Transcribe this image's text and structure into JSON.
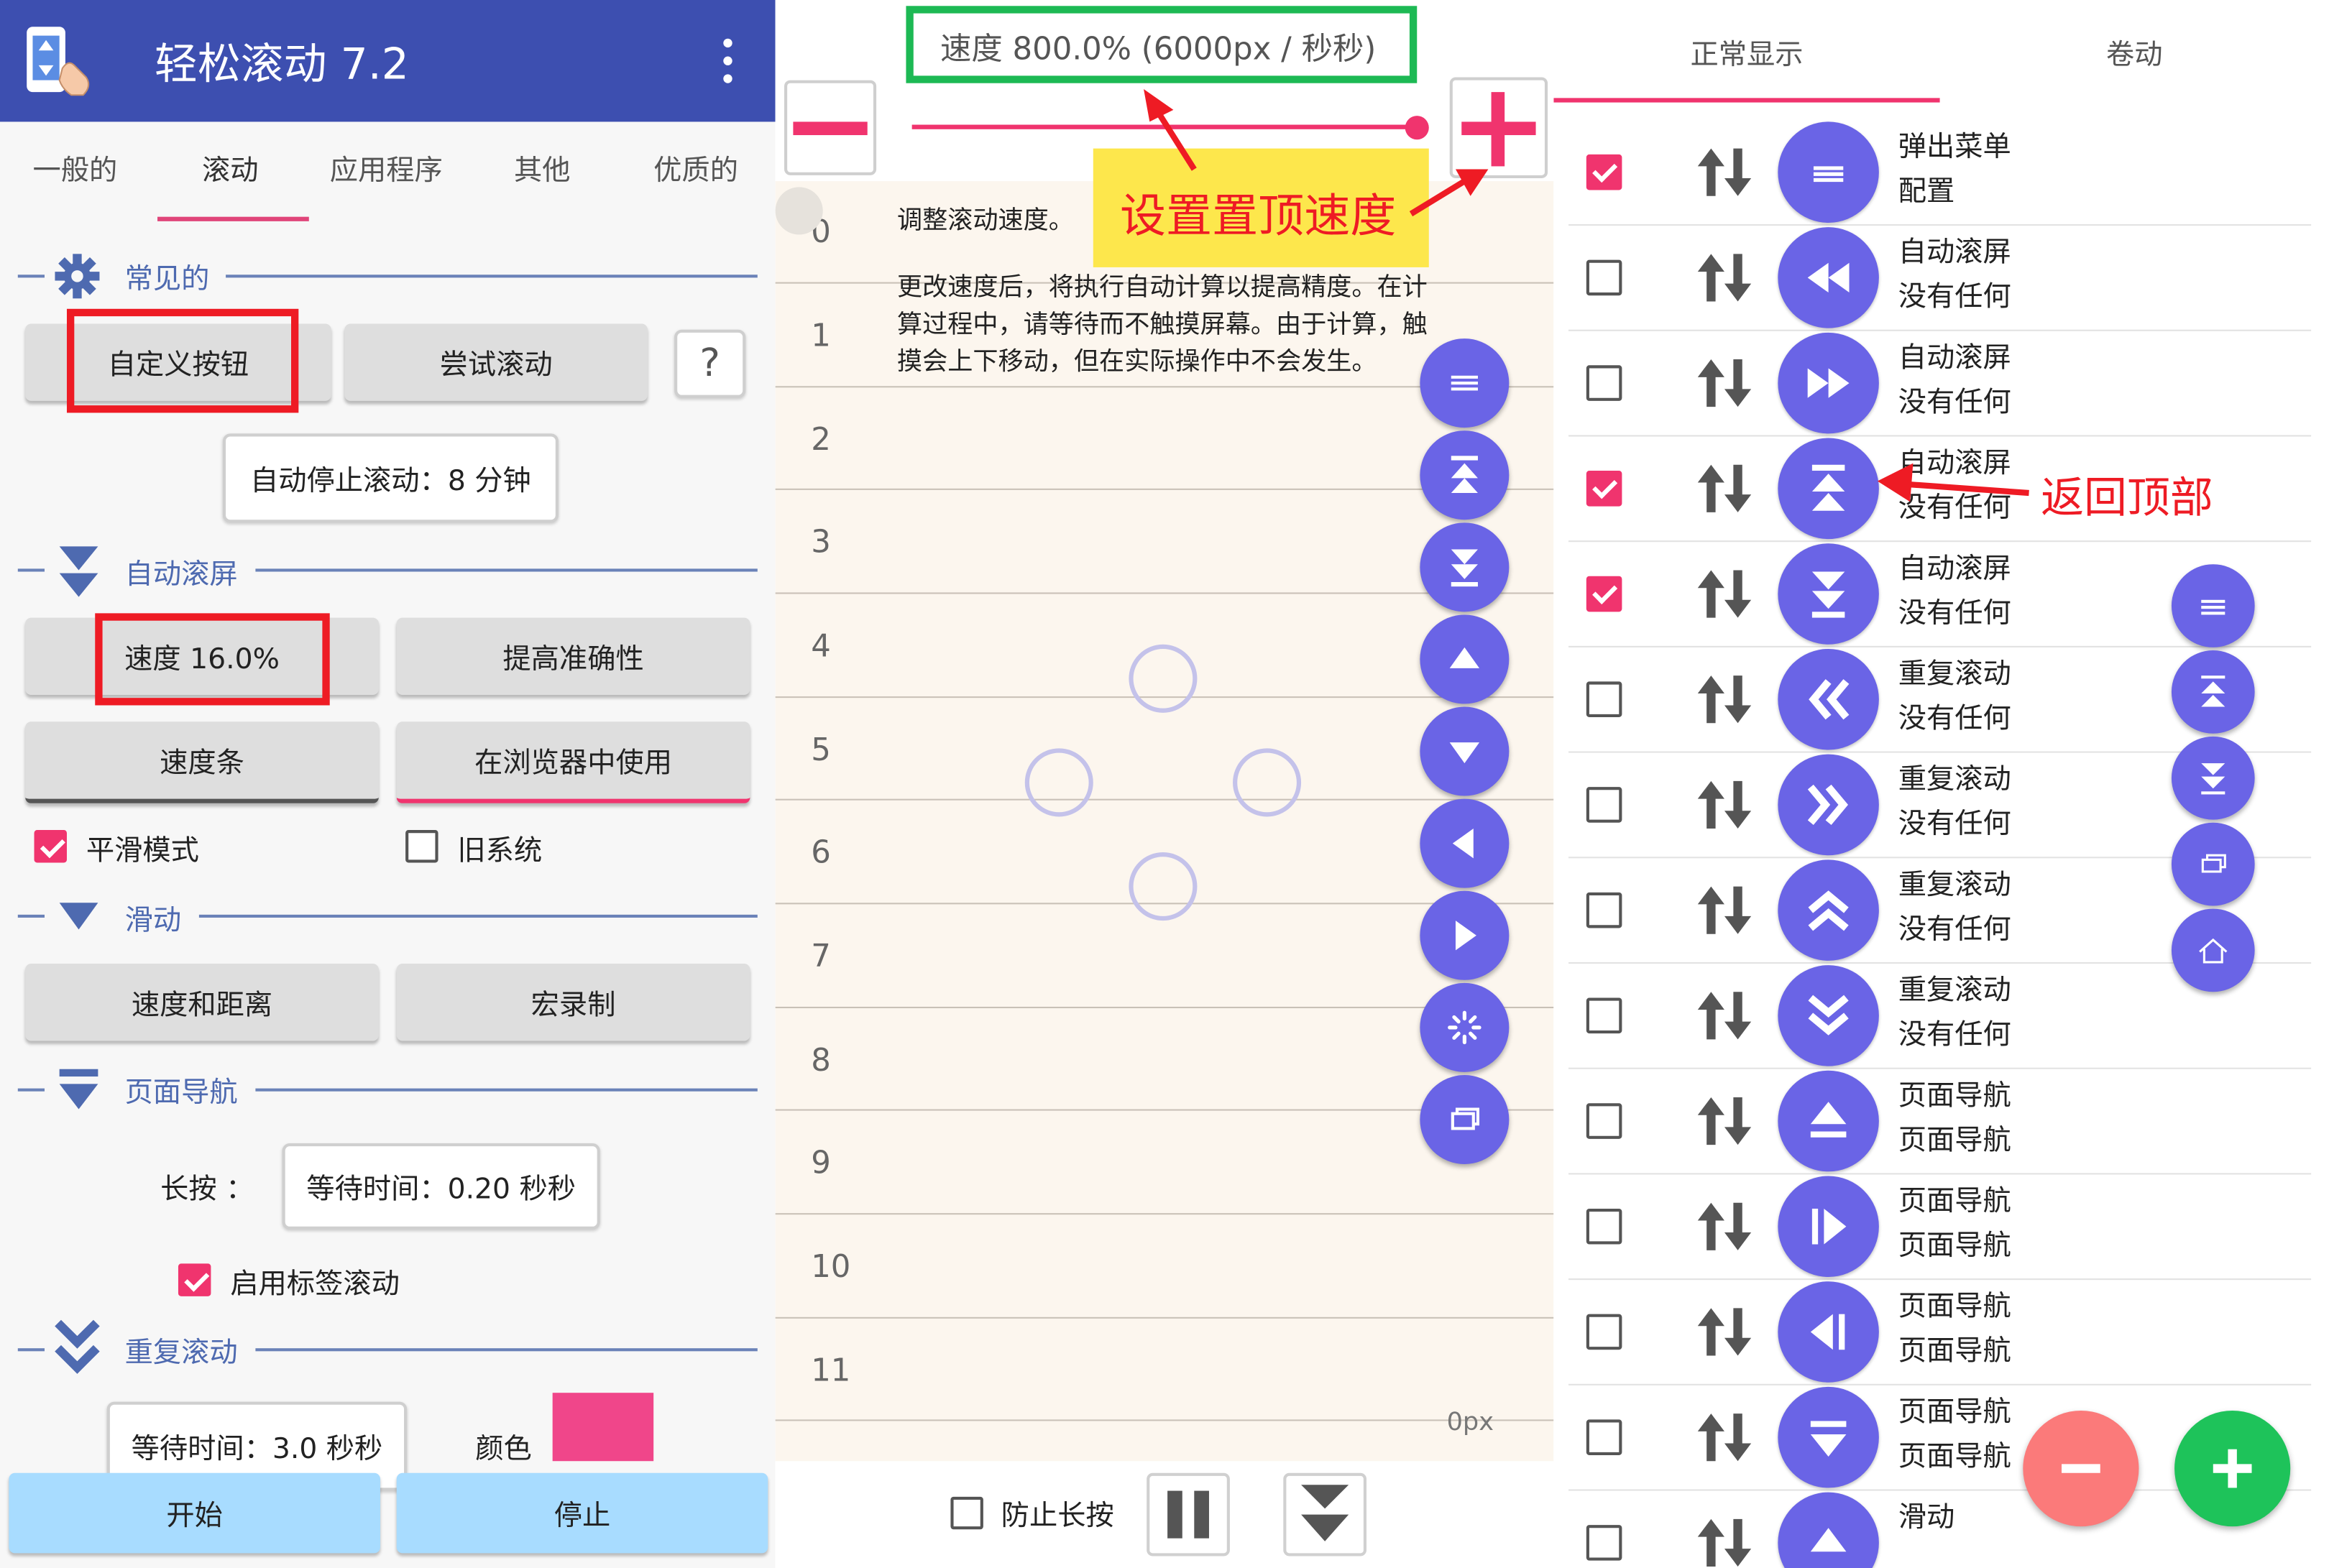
{
  "app": {
    "title": "轻松滚动 7.2",
    "tabs": [
      "一般的",
      "滚动",
      "应用程序",
      "其他",
      "优质的"
    ],
    "active_tab": "滚动"
  },
  "left": {
    "section_common": "常见的",
    "btn_custom": "自定义按钮",
    "btn_try_scroll": "尝试滚动",
    "help_label": "?",
    "btn_auto_stop": "自动停止滚动：8 分钟",
    "section_autoscroll": "自动滚屏",
    "btn_speed": "速度 16.0%",
    "btn_accuracy": "提高准确性",
    "btn_speed_bar": "速度条",
    "btn_browser": "在浏览器中使用",
    "smooth_mode": "平滑模式",
    "old_system": "旧系统",
    "section_swipe": "滑动",
    "btn_speed_distance": "速度和距离",
    "btn_macro": "宏录制",
    "section_page_nav": "页面导航",
    "long_press_label": "长按 ：",
    "btn_wait_time": "等待时间：0.20 秒秒",
    "enable_tab_scroll": "启用标签滚动",
    "section_repeat": "重复滚动",
    "btn_repeat_wait": "等待时间：3.0 秒秒",
    "color_label": "颜色",
    "color_swatch": "#f0468a",
    "btn_start": "开始",
    "btn_stop": "停止"
  },
  "middle": {
    "speed_header": "速度 800.0% (6000px / 秒秒)",
    "slider_fraction": 1.0,
    "annotation_set_speed": "设置置顶速度",
    "intro_line": "调整滚动速度。",
    "description": [
      "更改速度后，将执行自动计算以提高精度。在计",
      "算过程中，请等待而不触摸屏幕。由于计算，触",
      "摸会上下移动，但在实际操作中不会发生。"
    ],
    "row_numbers": [
      "0",
      "1",
      "2",
      "3",
      "4",
      "5",
      "6",
      "7",
      "8",
      "9",
      "10",
      "11"
    ],
    "px_readout": "0px",
    "prevent_long_press": "防止长按"
  },
  "right": {
    "tabs": [
      "正常显示",
      "卷动"
    ],
    "annotation_return_top": "返回顶部",
    "rows": [
      {
        "checked": true,
        "icon": "menu-icon",
        "line1": "弹出菜单",
        "line2": "配置"
      },
      {
        "checked": false,
        "icon": "rewind-icon",
        "line1": "自动滚屏",
        "line2": "没有任何"
      },
      {
        "checked": false,
        "icon": "fast-forward-icon",
        "line1": "自动滚屏",
        "line2": "没有任何"
      },
      {
        "checked": true,
        "icon": "scroll-to-top-icon",
        "line1": "自动滚屏",
        "line2": "没有任何"
      },
      {
        "checked": true,
        "icon": "scroll-to-bottom-icon",
        "line1": "自动滚屏",
        "line2": "没有任何"
      },
      {
        "checked": false,
        "icon": "double-left-icon",
        "line1": "重复滚动",
        "line2": "没有任何"
      },
      {
        "checked": false,
        "icon": "double-right-icon",
        "line1": "重复滚动",
        "line2": "没有任何"
      },
      {
        "checked": false,
        "icon": "double-up-icon",
        "line1": "重复滚动",
        "line2": "没有任何"
      },
      {
        "checked": false,
        "icon": "double-down-icon",
        "line1": "重复滚动",
        "line2": "没有任何"
      },
      {
        "checked": false,
        "icon": "page-up-icon",
        "line1": "页面导航",
        "line2": "页面导航"
      },
      {
        "checked": false,
        "icon": "page-next-icon",
        "line1": "页面导航",
        "line2": "页面导航"
      },
      {
        "checked": false,
        "icon": "page-prev-icon",
        "line1": "页面导航",
        "line2": "页面导航"
      },
      {
        "checked": false,
        "icon": "page-down-icon",
        "line1": "页面导航",
        "line2": "页面导航"
      },
      {
        "checked": false,
        "icon": "up-icon",
        "line1": "滑动",
        "line2": ""
      }
    ]
  },
  "colors": {
    "app_bar": "#3d4fb0",
    "accent_pink": "#f0346e",
    "fab_purple": "#6a64e6",
    "annotation_red": "#ee1b24",
    "annotation_yellow": "#fde74c",
    "highlight_green": "#1db954"
  }
}
